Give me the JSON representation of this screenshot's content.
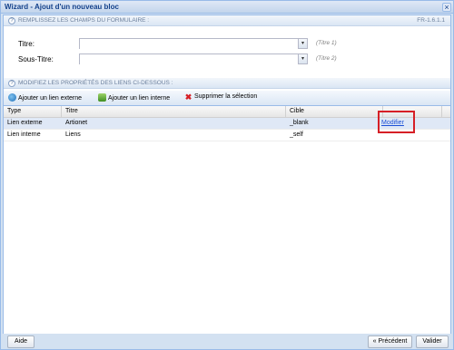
{
  "window": {
    "title": "Wizard - Ajout d'un nouveau bloc",
    "close_symbol": "×"
  },
  "section1": {
    "help": "?",
    "label": "REMPLISSEZ LES CHAMPS DU FORMULAIRE :",
    "code": "FR-1.6.1.1"
  },
  "form": {
    "title": {
      "label": "Titre:",
      "value": "",
      "hint": "(Titre 1)"
    },
    "subtitle": {
      "label": "Sous-Titre:",
      "value": "",
      "hint": "(Titre 2)"
    },
    "trigger_symbol": "▾"
  },
  "section2": {
    "help": "?",
    "label": "MODIFIEZ LES PROPRIÉTÉS DES LIENS CI-DESSOUS :"
  },
  "toolbar": {
    "add_external": "Ajouter un lien externe",
    "add_internal": "Ajouter un lien interne",
    "delete_selection": "Supprimer la sélection"
  },
  "grid": {
    "columns": [
      "Type",
      "Titre",
      "Cible",
      ""
    ],
    "rows": [
      {
        "type": "Lien externe",
        "title": "Artionet",
        "target": "_blank",
        "action": "Modifier"
      },
      {
        "type": "Lien interne",
        "title": "Liens",
        "target": "_self",
        "action": ""
      }
    ]
  },
  "footer": {
    "help": "Aide",
    "previous": "« Précédent",
    "validate": "Valider"
  },
  "colors": {
    "accent": "#15428b",
    "highlight": "#d61f26",
    "selected_row": "#dfe8f6"
  }
}
